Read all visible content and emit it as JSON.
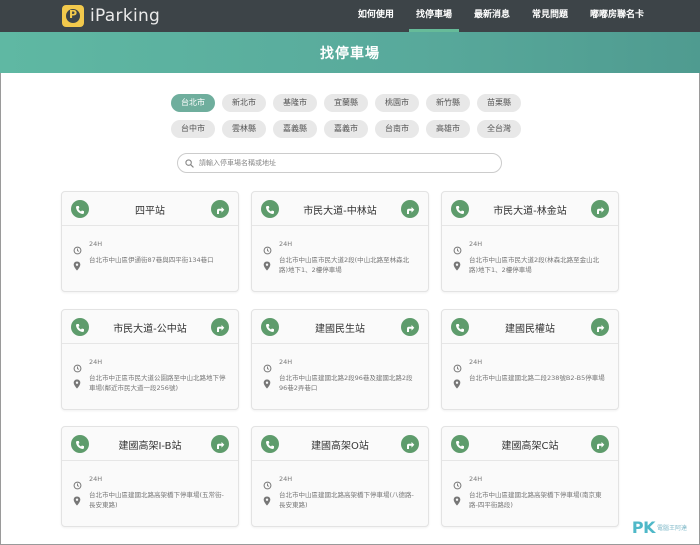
{
  "header": {
    "logo_text": "iParking",
    "nav": [
      {
        "label": "如何使用",
        "active": false
      },
      {
        "label": "找停車場",
        "active": true
      },
      {
        "label": "最新消息",
        "active": false
      },
      {
        "label": "常見問題",
        "active": false
      },
      {
        "label": "嘟嘟房聯名卡",
        "active": false
      }
    ]
  },
  "banner": {
    "title": "找停車場"
  },
  "cities": [
    {
      "label": "台北市",
      "active": true
    },
    {
      "label": "新北市",
      "active": false
    },
    {
      "label": "基隆市",
      "active": false
    },
    {
      "label": "宜蘭縣",
      "active": false
    },
    {
      "label": "桃園市",
      "active": false
    },
    {
      "label": "新竹縣",
      "active": false
    },
    {
      "label": "苗栗縣",
      "active": false
    },
    {
      "label": "台中市",
      "active": false
    },
    {
      "label": "雲林縣",
      "active": false
    },
    {
      "label": "嘉義縣",
      "active": false
    },
    {
      "label": "嘉義市",
      "active": false
    },
    {
      "label": "台南市",
      "active": false
    },
    {
      "label": "高雄市",
      "active": false
    },
    {
      "label": "全台灣",
      "active": false
    }
  ],
  "search": {
    "placeholder": "請輸入停車場名稱或地址"
  },
  "lots": [
    {
      "name": "四平站",
      "hours": "24H",
      "address": "台北市中山區伊通街87巷與四平街134巷口"
    },
    {
      "name": "市民大道-中林站",
      "hours": "24H",
      "address": "台北市中山區市民大道2段(中山北路至林森北路)地下1、2樓停車場"
    },
    {
      "name": "市民大道-林金站",
      "hours": "24H",
      "address": "台北市中山區市民大道2段(林森北路至金山北路)地下1、2樓停車場"
    },
    {
      "name": "市民大道-公中站",
      "hours": "24H",
      "address": "台北市中正區市民大道公園路至中山北路地下停車場(鄰近市民大道一段256號)"
    },
    {
      "name": "建國民生站",
      "hours": "24H",
      "address": "台北市中山區建國北路2段96巷及建國北路2段96巷2弄巷口"
    },
    {
      "name": "建國民權站",
      "hours": "24H",
      "address": "台北市中山區建國北路二段238號B2-B5停車場"
    },
    {
      "name": "建國高架I-B站",
      "hours": "24H",
      "address": "台北市中山區建國北路高架橋下停車場(五常街-長安東路)"
    },
    {
      "name": "建國高架O站",
      "hours": "24H",
      "address": "台北市中山區建國北路高架橋下停車場(八德路-長安東路)"
    },
    {
      "name": "建國高架C站",
      "hours": "24H",
      "address": "台北市中山區建國北路高架橋下停車場(南京東路-四平街路段)"
    }
  ],
  "watermark": {
    "brand_main": "PK",
    "brand_accent": "",
    "sub": "電腦王阿達"
  },
  "colors": {
    "nav_bg": "#3d4448",
    "accent": "#6fae9d",
    "icon_green": "#5e9c6c"
  },
  "icons": {
    "phone": "phone-icon",
    "navigate": "navigate-icon",
    "clock": "clock-icon",
    "pin": "location-pin-icon",
    "search": "search-icon"
  }
}
